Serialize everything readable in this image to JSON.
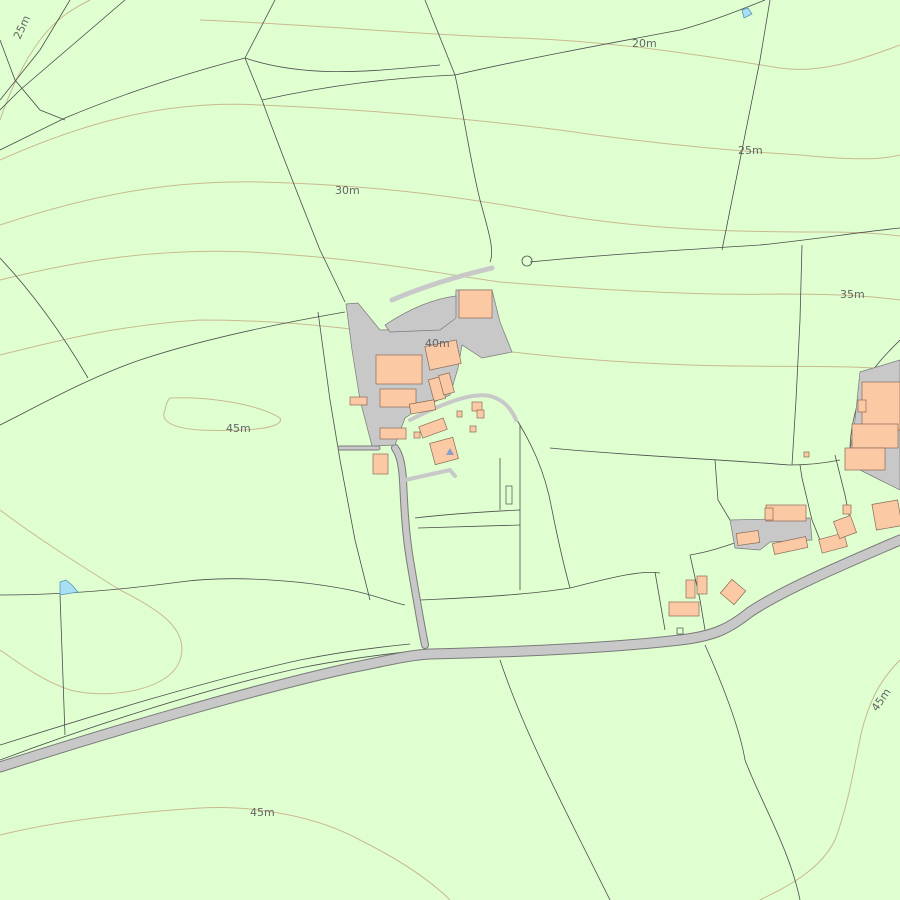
{
  "map": {
    "colors": {
      "land": "#dfffd0",
      "contour": "#c9b98f",
      "boundary": "#4d4d4d",
      "road": "#c8c8c8",
      "building": "#fbc9a3",
      "water": "#a9dff5",
      "label": "#666666"
    },
    "contour_labels": {
      "c25_nw": "25m",
      "c20_n": "20m",
      "c25_ne": "25m",
      "c30": "30m",
      "c35": "35m",
      "c40": "40m",
      "c45_w": "45m",
      "c45_sw": "45m",
      "c45_se": "45m"
    },
    "symbols": {
      "spot_marker": "triangle-icon"
    }
  }
}
